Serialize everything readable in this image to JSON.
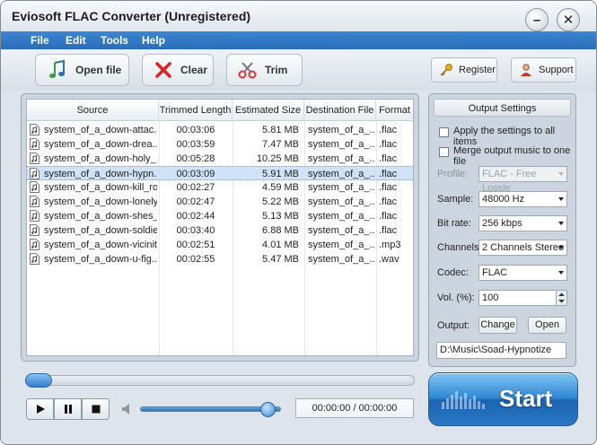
{
  "window": {
    "title": "Eviosoft FLAC Converter (Unregistered)",
    "minimize_glyph": "–",
    "close_glyph": "✕"
  },
  "menu": [
    "File",
    "Edit",
    "Tools",
    "Help"
  ],
  "toolbar": {
    "open_label": "Open file",
    "clear_label": "Clear",
    "trim_label": "Trim",
    "register_label": "Register",
    "support_label": "Support"
  },
  "table": {
    "columns": [
      "Source",
      "Trimmed Length",
      "Estimated Size",
      "Destination File",
      "Format"
    ],
    "selected_index": 3,
    "rows": [
      {
        "source": "system_of_a_down-attac...",
        "length": "00:03:06",
        "size": "5.81 MB",
        "dest": "system_of_a_...",
        "format": ".flac"
      },
      {
        "source": "system_of_a_down-drea...",
        "length": "00:03:59",
        "size": "7.47 MB",
        "dest": "system_of_a_...",
        "format": ".flac"
      },
      {
        "source": "system_of_a_down-holy_...",
        "length": "00:05:28",
        "size": "10.25 MB",
        "dest": "system_of_a_...",
        "format": ".flac"
      },
      {
        "source": "system_of_a_down-hypn...",
        "length": "00:03:09",
        "size": "5.91 MB",
        "dest": "system_of_a_...",
        "format": ".flac"
      },
      {
        "source": "system_of_a_down-kill_ro...",
        "length": "00:02:27",
        "size": "4.59 MB",
        "dest": "system_of_a_...",
        "format": ".flac"
      },
      {
        "source": "system_of_a_down-lonely...",
        "length": "00:02:47",
        "size": "5.22 MB",
        "dest": "system_of_a_...",
        "format": ".flac"
      },
      {
        "source": "system_of_a_down-shes_...",
        "length": "00:02:44",
        "size": "5.13 MB",
        "dest": "system_of_a_...",
        "format": ".flac"
      },
      {
        "source": "system_of_a_down-soldie...",
        "length": "00:03:40",
        "size": "6.88 MB",
        "dest": "system_of_a_...",
        "format": ".flac"
      },
      {
        "source": "system_of_a_down-vicinit...",
        "length": "00:02:51",
        "size": "4.01 MB",
        "dest": "system_of_a_...",
        "format": ".mp3"
      },
      {
        "source": "system_of_a_down-u-fig...",
        "length": "00:02:55",
        "size": "5.47 MB",
        "dest": "system_of_a_...",
        "format": ".wav"
      }
    ]
  },
  "settings": {
    "title": "Output Settings",
    "apply_all_label": "Apply the settings to all  items",
    "apply_all_checked": false,
    "merge_label": "Merge output music to one file",
    "merge_checked": false,
    "profile_label": "Profile:",
    "profile_value": "FLAC - Free Lossle",
    "sample_label": "Sample:",
    "sample_value": "48000 Hz",
    "bitrate_label": "Bit rate:",
    "bitrate_value": "256 kbps",
    "channels_label": "Channels:",
    "channels_value": "2 Channels Stereo",
    "codec_label": "Codec:",
    "codec_value": "FLAC",
    "vol_label": "Vol. (%):",
    "vol_value": "100",
    "output_label": "Output:",
    "change_label": "Change",
    "open_label": "Open",
    "output_path": "D:\\Music\\Soad-Hypnotize"
  },
  "player": {
    "time": "00:00:00 / 00:00:00",
    "seek_fraction": 0.0,
    "volume_fraction": 0.95
  },
  "start_label": "Start",
  "colors": {
    "menubar": "#2f76c4",
    "selection": "#cfe2f7",
    "start": "#2f86d3"
  }
}
